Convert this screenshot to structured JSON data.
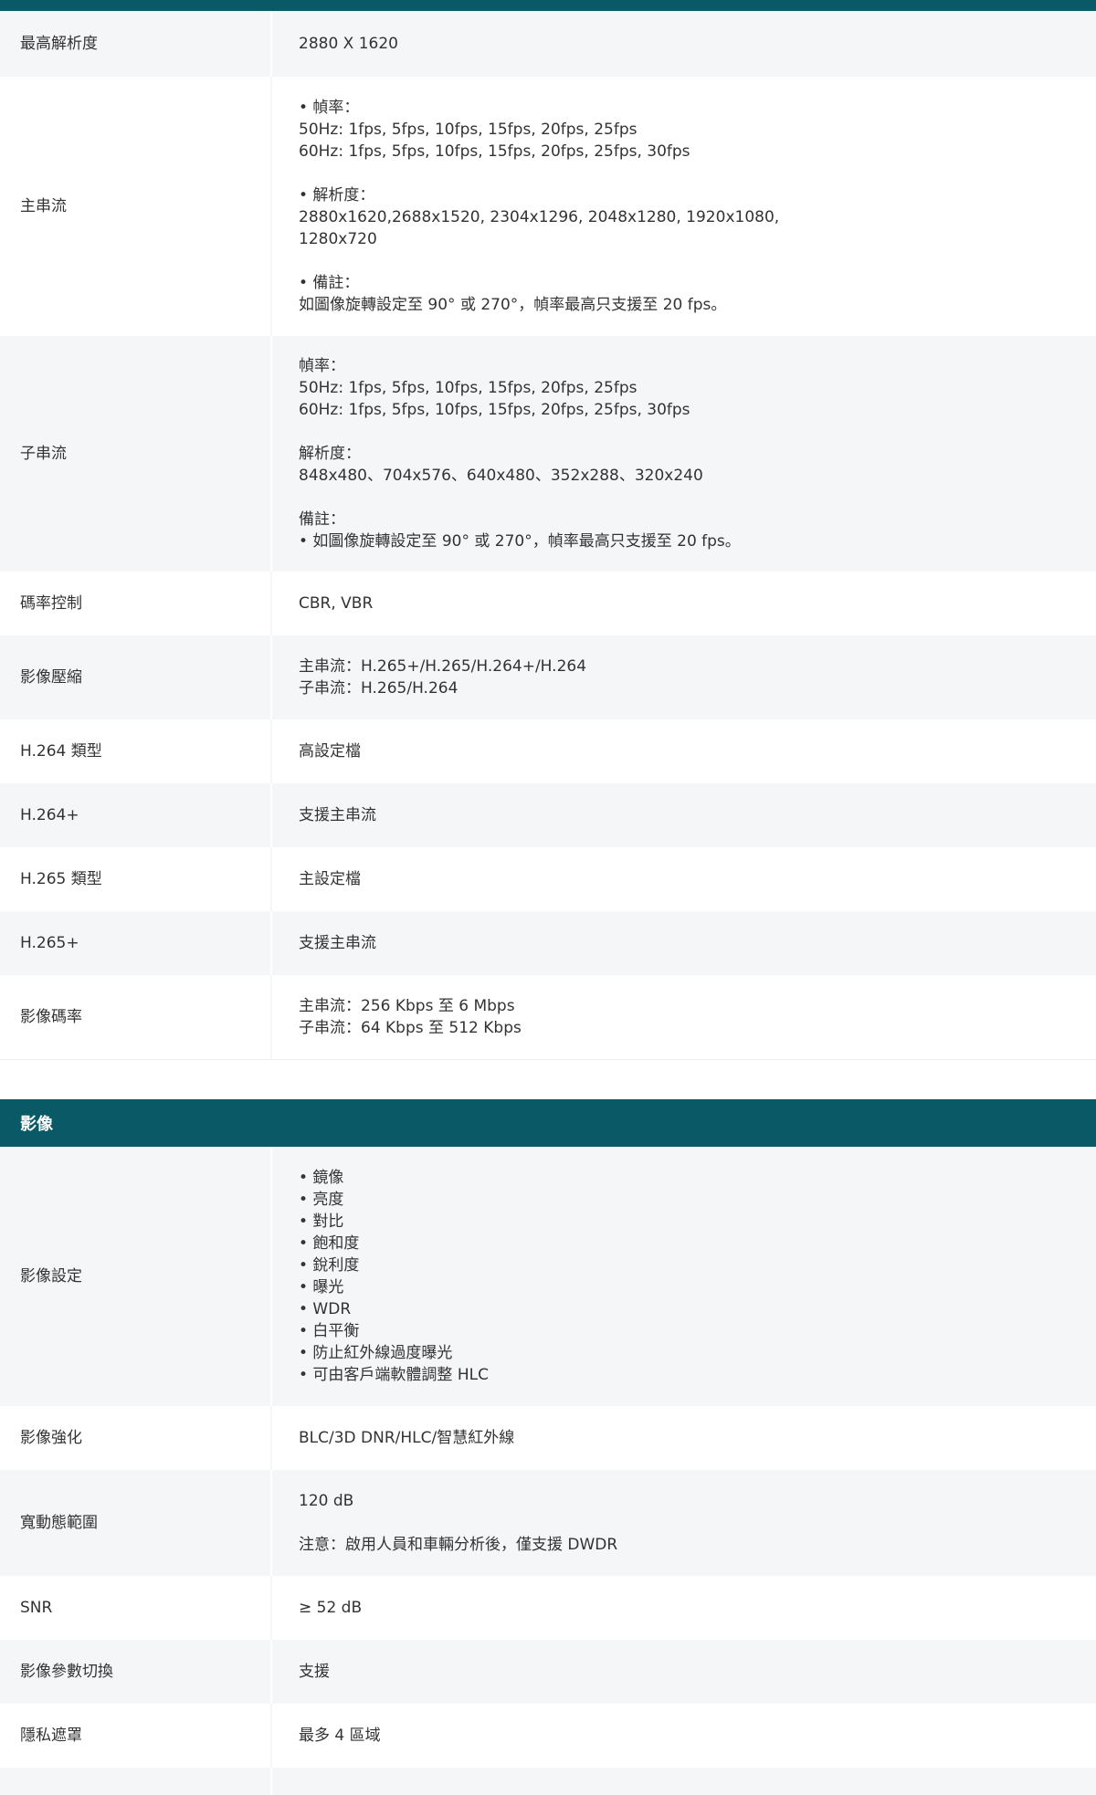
{
  "video": {
    "max_resolution": {
      "label": "最高解析度",
      "value": "2880 X 1620"
    },
    "main_stream": {
      "label": "主串流",
      "lines": [
        "• 幀率：",
        "50Hz: 1fps, 5fps, 10fps, 15fps, 20fps, 25fps",
        "60Hz: 1fps, 5fps, 10fps, 15fps, 20fps, 25fps, 30fps",
        "",
        "• 解析度：",
        "2880x1620,2688x1520, 2304x1296, 2048x1280, 1920x1080,",
        "1280x720",
        "",
        "• 備註：",
        "如圖像旋轉設定至 90° 或 270°，幀率最高只支援至 20 fps。"
      ]
    },
    "sub_stream": {
      "label": "子串流",
      "lines": [
        "幀率：",
        "50Hz: 1fps, 5fps, 10fps, 15fps, 20fps, 25fps",
        "60Hz: 1fps, 5fps, 10fps, 15fps, 20fps, 25fps, 30fps",
        "",
        "解析度：",
        "848x480、704x576、640x480、352x288、320x240",
        "",
        "備註：",
        "• 如圖像旋轉設定至 90° 或 270°，幀率最高只支援至 20 fps。"
      ]
    },
    "bitrate_control": {
      "label": "碼率控制",
      "value": "CBR, VBR"
    },
    "video_compression": {
      "label": "影像壓縮",
      "lines": [
        "主串流：H.265+/H.265/H.264+/H.264",
        "子串流：H.265/H.264"
      ]
    },
    "h264_type": {
      "label": "H.264 類型",
      "value": "高設定檔"
    },
    "h264_plus": {
      "label": "H.264+",
      "value": "支援主串流"
    },
    "h265_type": {
      "label": "H.265 類型",
      "value": "主設定檔"
    },
    "h265_plus": {
      "label": "H.265+",
      "value": "支援主串流"
    },
    "video_bitrate": {
      "label": "影像碼率",
      "lines": [
        "主串流：256 Kbps 至 6 Mbps",
        "子串流：64 Kbps 至 512 Kbps"
      ]
    }
  },
  "image": {
    "section_title": "影像",
    "image_settings": {
      "label": "影像設定",
      "lines": [
        "• 鏡像",
        "• 亮度",
        "• 對比",
        "• 飽和度",
        "• 銳利度",
        "• 曝光",
        "• WDR",
        "• 白平衡",
        "• 防止紅外線過度曝光",
        "• 可由客戶端軟體調整 HLC"
      ]
    },
    "image_enhancement": {
      "label": "影像強化",
      "value": "BLC/3D DNR/HLC/智慧紅外線"
    },
    "wdr": {
      "label": "寬動態範圍",
      "value": "120 dB",
      "note": "注意：啟用人員和車輛分析後，僅支援 DWDR"
    },
    "snr": {
      "label": "SNR",
      "value": "≥ 52 dB"
    },
    "image_param_switch": {
      "label": "影像參數切換",
      "value": "支援"
    },
    "privacy_mask": {
      "label": "隱私遮罩",
      "value": "最多 4 區域"
    }
  },
  "colors": {
    "header": "#0a5967",
    "row_shade": "#f5f6f8",
    "text": "#333333"
  }
}
